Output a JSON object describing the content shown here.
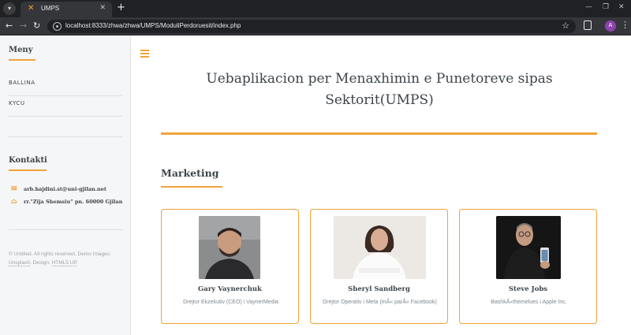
{
  "browser": {
    "tab_title": "UMPS",
    "url": "localhost:8333/zhwa/zhwa/UMPS/ModuliPerdoruesit/index.php",
    "profile_initial": "A"
  },
  "sidebar": {
    "menu_heading": "Meny",
    "menu_items": [
      {
        "label": "BALLINA"
      },
      {
        "label": "KYCU"
      }
    ],
    "contact_heading": "Kontakti",
    "contacts": [
      {
        "icon": "envelope-icon",
        "text": "arb.hajdini.st@uni-gjilan.net"
      },
      {
        "icon": "home-icon",
        "text": "rr.\"Zija Shemsiu\" pn. 60000 Gjilan"
      }
    ],
    "footer": {
      "text": "© Untitled. All rights reserved. Demo Images:",
      "link1": "Unsplash",
      "middle": ". Design:",
      "link2": "HTML5 UP",
      "end": "."
    }
  },
  "main": {
    "title": "Uebaplikacion per Menaxhimin e Punetoreve sipas Sektorit(UMPS)",
    "section_title": "Marketing",
    "cards": [
      {
        "name": "Gary Vaynerchuk",
        "role": "Drejtor Ekzekutiv (CEO) i VaynerMedia"
      },
      {
        "name": "Sheryl Sandberg",
        "role": "Drejtor Operativ i Meta (mÃ« parÃ« Facebook)"
      },
      {
        "name": "Steve Jobs",
        "role": "BashkÃ«themelues i Apple Inc."
      }
    ]
  },
  "colors": {
    "accent": "#f2a23a",
    "text": "#3d4449",
    "sidebar_bg": "#f5f6f7"
  }
}
